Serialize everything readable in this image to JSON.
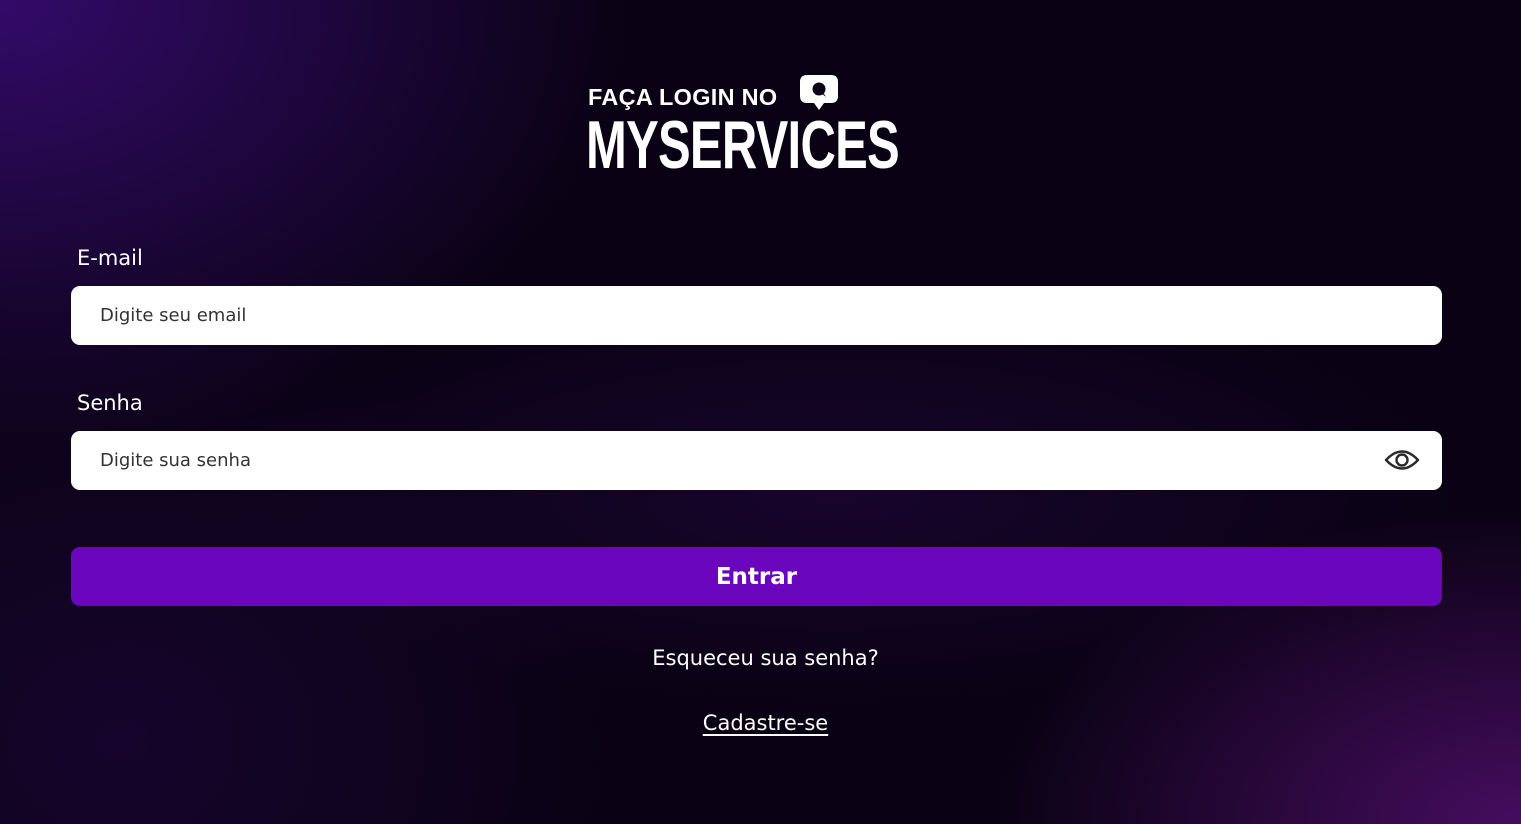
{
  "brand": {
    "tagline": "FAÇA LOGIN NO",
    "name": "MYSERVICES",
    "logo_icon": "chat-bubble-icon"
  },
  "form": {
    "email": {
      "label": "E-mail",
      "placeholder": "Digite seu email",
      "value": ""
    },
    "password": {
      "label": "Senha",
      "placeholder": "Digite sua senha",
      "value": "",
      "toggle_icon": "eye-icon"
    },
    "submit_label": "Entrar"
  },
  "links": {
    "forgot_password": "Esqueceu sua senha?",
    "signup": "Cadastre-se"
  },
  "colors": {
    "accent": "#6a06bd",
    "background": "#0a0214",
    "input_bg": "#ffffff"
  }
}
